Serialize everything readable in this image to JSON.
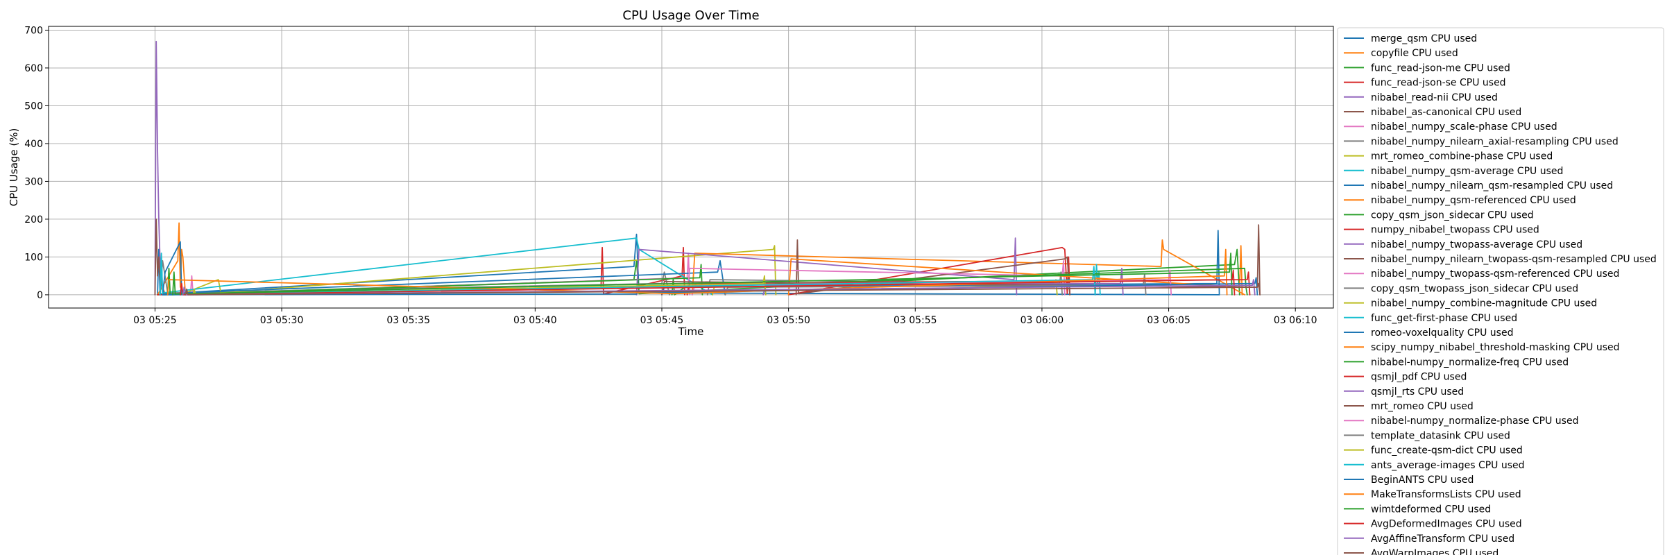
{
  "chart_data": {
    "type": "line",
    "title": "CPU Usage Over Time",
    "xlabel": "Time",
    "ylabel": "CPU Usage (%)",
    "x_unit": "minutes after 03 05:25",
    "xlim": [
      -4.2,
      46.5
    ],
    "ylim": [
      -35,
      710
    ],
    "grid": true,
    "legend_position": "outside right, top",
    "x_ticks": [
      {
        "value": 0,
        "label": "03 05:25"
      },
      {
        "value": 5,
        "label": "03 05:30"
      },
      {
        "value": 10,
        "label": "03 05:35"
      },
      {
        "value": 15,
        "label": "03 05:40"
      },
      {
        "value": 20,
        "label": "03 05:45"
      },
      {
        "value": 25,
        "label": "03 05:50"
      },
      {
        "value": 30,
        "label": "03 05:55"
      },
      {
        "value": 35,
        "label": "03 06:00"
      },
      {
        "value": 40,
        "label": "03 06:05"
      },
      {
        "value": 45,
        "label": "03 06:10"
      }
    ],
    "y_ticks": [
      0,
      100,
      200,
      300,
      400,
      500,
      600,
      700
    ],
    "series": [
      {
        "name": "merge_qsm CPU used",
        "color": "#1f77b4",
        "x": [
          0.1,
          0.15,
          0.2,
          18.9,
          19.0,
          19.1,
          42.0
        ],
        "y": [
          0,
          120,
          2,
          75,
          160,
          5,
          0
        ]
      },
      {
        "name": "copyfile CPU used",
        "color": "#ff7f0e",
        "x": [
          0.1,
          0.9,
          0.95,
          1.0,
          1.05,
          1.1,
          1.2
        ],
        "y": [
          0,
          90,
          190,
          20,
          120,
          100,
          0
        ]
      },
      {
        "name": "func_read-json-me CPU used",
        "color": "#2ca02c",
        "x": [
          0.1,
          18.9,
          19.0,
          19.1,
          42.6,
          42.7,
          42.8
        ],
        "y": [
          0,
          40,
          90,
          3,
          80,
          120,
          0
        ]
      },
      {
        "name": "func_read-json-se CPU used",
        "color": "#d62728",
        "x": [
          0.1,
          17.6,
          17.65,
          17.7,
          20.8,
          20.85,
          20.9
        ],
        "y": [
          0,
          18,
          125,
          2,
          50,
          125,
          0
        ]
      },
      {
        "name": "nibabel_read-nii CPU used",
        "color": "#9467bd",
        "x": [
          0.0,
          0.05,
          0.1,
          0.15,
          0.2,
          0.3
        ],
        "y": [
          0,
          670,
          380,
          200,
          90,
          0
        ]
      },
      {
        "name": "nibabel_as-canonical CPU used",
        "color": "#8c564b",
        "x": [
          0.0,
          0.05,
          0.1,
          0.15,
          0.2,
          0.4
        ],
        "y": [
          0,
          200,
          50,
          100,
          40,
          0
        ]
      },
      {
        "name": "nibabel_numpy_scale-phase CPU used",
        "color": "#e377c2",
        "x": [
          1.4,
          1.45,
          1.5,
          21.0,
          21.05,
          21.1
        ],
        "y": [
          0,
          50,
          2,
          45,
          110,
          0
        ]
      },
      {
        "name": "nibabel_numpy_nilearn_axial-resampling CPU used",
        "color": "#7f7f7f",
        "x": [
          0.2,
          0.3,
          0.5,
          20.0,
          20.1,
          20.3
        ],
        "y": [
          0,
          90,
          5,
          30,
          60,
          0
        ]
      },
      {
        "name": "mrt_romeo_combine-phase CPU used",
        "color": "#bcbd22",
        "x": [
          1.0,
          2.5,
          2.6,
          24.4,
          24.45,
          24.5
        ],
        "y": [
          0,
          40,
          5,
          120,
          130,
          0
        ]
      },
      {
        "name": "nibabel_numpy_qsm-average CPU used",
        "color": "#17becf",
        "x": [
          0.2,
          0.25,
          0.3,
          19.0,
          19.1,
          22.0
        ],
        "y": [
          0,
          100,
          5,
          150,
          120,
          0
        ]
      },
      {
        "name": "nibabel_numpy_nilearn_qsm-resampled CPU used",
        "color": "#1f77b4",
        "x": [
          0.3,
          0.4,
          1.0,
          1.05,
          22.2,
          22.3,
          22.5
        ],
        "y": [
          0,
          60,
          140,
          5,
          60,
          90,
          0
        ]
      },
      {
        "name": "nibabel_numpy_qsm-referenced CPU used",
        "color": "#ff7f0e",
        "x": [
          21.2,
          21.3,
          39.7,
          39.75,
          39.8,
          43.0
        ],
        "y": [
          0,
          110,
          75,
          145,
          120,
          0
        ]
      },
      {
        "name": "copy_qsm_json_sidecar CPU used",
        "color": "#2ca02c",
        "x": [
          0.5,
          0.55,
          0.6,
          21.5,
          21.55,
          21.6
        ],
        "y": [
          0,
          70,
          0,
          45,
          80,
          0
        ]
      },
      {
        "name": "numpy_nibabel_twopass CPU used",
        "color": "#d62728",
        "x": [
          25.0,
          35.8,
          35.9,
          36.0,
          36.05,
          36.1
        ],
        "y": [
          0,
          125,
          120,
          3,
          100,
          0
        ]
      },
      {
        "name": "nibabel_numpy_twopass-average CPU used",
        "color": "#9467bd",
        "x": [
          19.0,
          19.1,
          33.9,
          33.95,
          34.0
        ],
        "y": [
          0,
          120,
          40,
          150,
          0
        ]
      },
      {
        "name": "nibabel_numpy_nilearn_twopass-qsm-resampled CPU used",
        "color": "#8c564b",
        "x": [
          25.3,
          25.35,
          25.4,
          35.9,
          36.0,
          36.1
        ],
        "y": [
          0,
          145,
          3,
          95,
          100,
          0
        ]
      },
      {
        "name": "nibabel_numpy_twopass-qsm-referenced CPU used",
        "color": "#e377c2",
        "x": [
          21.0,
          21.1,
          35.8,
          35.85,
          35.9
        ],
        "y": [
          0,
          70,
          50,
          90,
          0
        ]
      },
      {
        "name": "copy_qsm_twopass_json_sidecar CPU used",
        "color": "#7f7f7f",
        "x": [
          21.8,
          21.9,
          35.7,
          35.75,
          35.8
        ],
        "y": [
          0,
          40,
          30,
          60,
          0
        ]
      },
      {
        "name": "nibabel_numpy_combine-magnitude CPU used",
        "color": "#bcbd22",
        "x": [
          22.0,
          22.1,
          35.5,
          35.55,
          35.6
        ],
        "y": [
          0,
          30,
          20,
          40,
          0
        ]
      },
      {
        "name": "func_get-first-phase CPU used",
        "color": "#17becf",
        "x": [
          37.1,
          37.15,
          37.2,
          37.25,
          37.3
        ],
        "y": [
          0,
          80,
          30,
          60,
          0
        ]
      },
      {
        "name": "romeo-voxelquality CPU used",
        "color": "#1f77b4",
        "x": [
          20.0,
          20.1,
          41.9,
          41.95,
          42.0
        ],
        "y": [
          0,
          20,
          30,
          170,
          0
        ]
      },
      {
        "name": "scipy_numpy_nibabel_threshold-masking CPU used",
        "color": "#ff7f0e",
        "x": [
          25.0,
          25.1,
          42.8,
          42.85,
          42.9
        ],
        "y": [
          0,
          95,
          20,
          130,
          0
        ]
      },
      {
        "name": "nibabel-numpy_normalize-freq CPU used",
        "color": "#2ca02c",
        "x": [
          20.4,
          20.45,
          20.5,
          20.9,
          43.0,
          43.05,
          43.1
        ],
        "y": [
          0,
          40,
          0,
          20,
          70,
          20,
          0
        ]
      },
      {
        "name": "qsmjl_pdf CPU used",
        "color": "#d62728",
        "x": [
          21.0,
          21.1,
          43.1,
          43.15,
          43.2
        ],
        "y": [
          0,
          30,
          40,
          60,
          0
        ]
      },
      {
        "name": "qsmjl_rts CPU used",
        "color": "#9467bd",
        "x": [
          24.0,
          24.1,
          38.1,
          38.15,
          38.2
        ],
        "y": [
          0,
          25,
          30,
          70,
          0
        ]
      },
      {
        "name": "mrt_romeo CPU used",
        "color": "#8c564b",
        "x": [
          20.0,
          20.1,
          43.5,
          43.55,
          43.6
        ],
        "y": [
          0,
          35,
          20,
          185,
          0
        ]
      },
      {
        "name": "nibabel-numpy_normalize-phase CPU used",
        "color": "#e377c2",
        "x": [
          21.2,
          21.3,
          40.0,
          40.05,
          40.1
        ],
        "y": [
          0,
          25,
          40,
          65,
          0
        ]
      },
      {
        "name": "template_datasink CPU used",
        "color": "#7f7f7f",
        "x": [
          22.5,
          22.6,
          39.0,
          39.05,
          39.1
        ],
        "y": [
          0,
          20,
          25,
          55,
          0
        ]
      },
      {
        "name": "func_create-qsm-dict CPU used",
        "color": "#bcbd22",
        "x": [
          1.5,
          1.55,
          1.6,
          24.0,
          24.05,
          24.1
        ],
        "y": [
          0,
          15,
          0,
          30,
          50,
          0
        ]
      },
      {
        "name": "ants_average-images CPU used",
        "color": "#17becf",
        "x": [
          0.2,
          0.25,
          0.3,
          37.0,
          37.05,
          37.1
        ],
        "y": [
          0,
          110,
          0,
          40,
          75,
          0
        ]
      },
      {
        "name": "BeginANTS CPU used",
        "color": "#1f77b4",
        "x": [
          0.3,
          19.0,
          19.05,
          43.4,
          43.45,
          43.5
        ],
        "y": [
          0,
          2,
          5,
          30,
          45,
          0
        ]
      },
      {
        "name": "MakeTransformsLists CPU used",
        "color": "#ff7f0e",
        "x": [
          0.5,
          0.55,
          20.5,
          42.2,
          42.25,
          42.3
        ],
        "y": [
          0,
          40,
          3,
          50,
          120,
          0
        ]
      },
      {
        "name": "wimtdeformed CPU used",
        "color": "#2ca02c",
        "x": [
          0.7,
          0.75,
          0.8,
          42.4,
          42.45,
          42.5
        ],
        "y": [
          0,
          60,
          2,
          60,
          110,
          0
        ]
      },
      {
        "name": "AvgDeformedImages CPU used",
        "color": "#d62728",
        "x": [
          1.0,
          1.05,
          1.1,
          42.5,
          42.55,
          42.6
        ],
        "y": [
          0,
          30,
          0,
          40,
          65,
          0
        ]
      },
      {
        "name": "AvgAffineTransform CPU used",
        "color": "#9467bd",
        "x": [
          1.1,
          1.15,
          1.2,
          43.3,
          43.35,
          43.4
        ],
        "y": [
          0,
          20,
          0,
          25,
          40,
          0
        ]
      },
      {
        "name": "AvgWarpImages CPU used",
        "color": "#8c564b",
        "x": [
          1.2,
          1.25,
          1.3,
          43.5,
          43.55,
          43.6
        ],
        "y": [
          0,
          15,
          0,
          20,
          30,
          0
        ]
      }
    ]
  }
}
